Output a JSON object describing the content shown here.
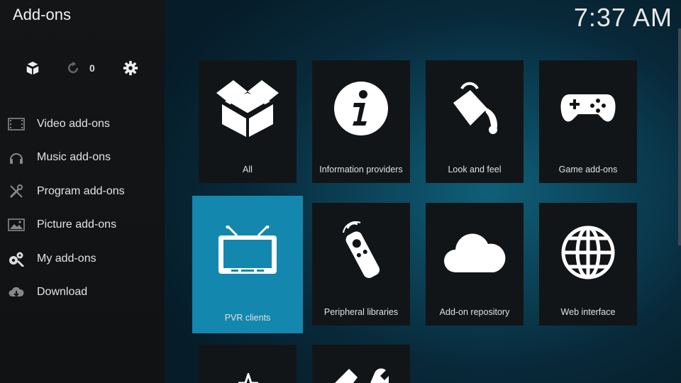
{
  "header": {
    "title": "Add-ons",
    "clock": "7:37 AM"
  },
  "toolbar": {
    "update_count": "0"
  },
  "sidebar": {
    "items": [
      {
        "label": "Video add-ons",
        "icon": "film-icon"
      },
      {
        "label": "Music add-ons",
        "icon": "headphones-icon"
      },
      {
        "label": "Program add-ons",
        "icon": "tools-icon"
      },
      {
        "label": "Picture add-ons",
        "icon": "picture-icon"
      },
      {
        "label": "My add-ons",
        "icon": "gears-icon"
      },
      {
        "label": "Download",
        "icon": "cloud-download-icon"
      }
    ]
  },
  "grid": {
    "tiles": [
      {
        "label": "All",
        "icon": "open-box-icon"
      },
      {
        "label": "Information providers",
        "icon": "info-icon"
      },
      {
        "label": "Look and feel",
        "icon": "paint-bucket-icon"
      },
      {
        "label": "Game add-ons",
        "icon": "gamepad-icon"
      },
      {
        "label": "PVR clients",
        "icon": "tv-icon",
        "focused": true
      },
      {
        "label": "Peripheral libraries",
        "icon": "remote-icon"
      },
      {
        "label": "Add-on repository",
        "icon": "cloud-icon"
      },
      {
        "label": "Web interface",
        "icon": "globe-icon"
      }
    ]
  },
  "colors": {
    "focus": "#1487ae",
    "tile": "#121517",
    "sidebar": "#131517"
  }
}
